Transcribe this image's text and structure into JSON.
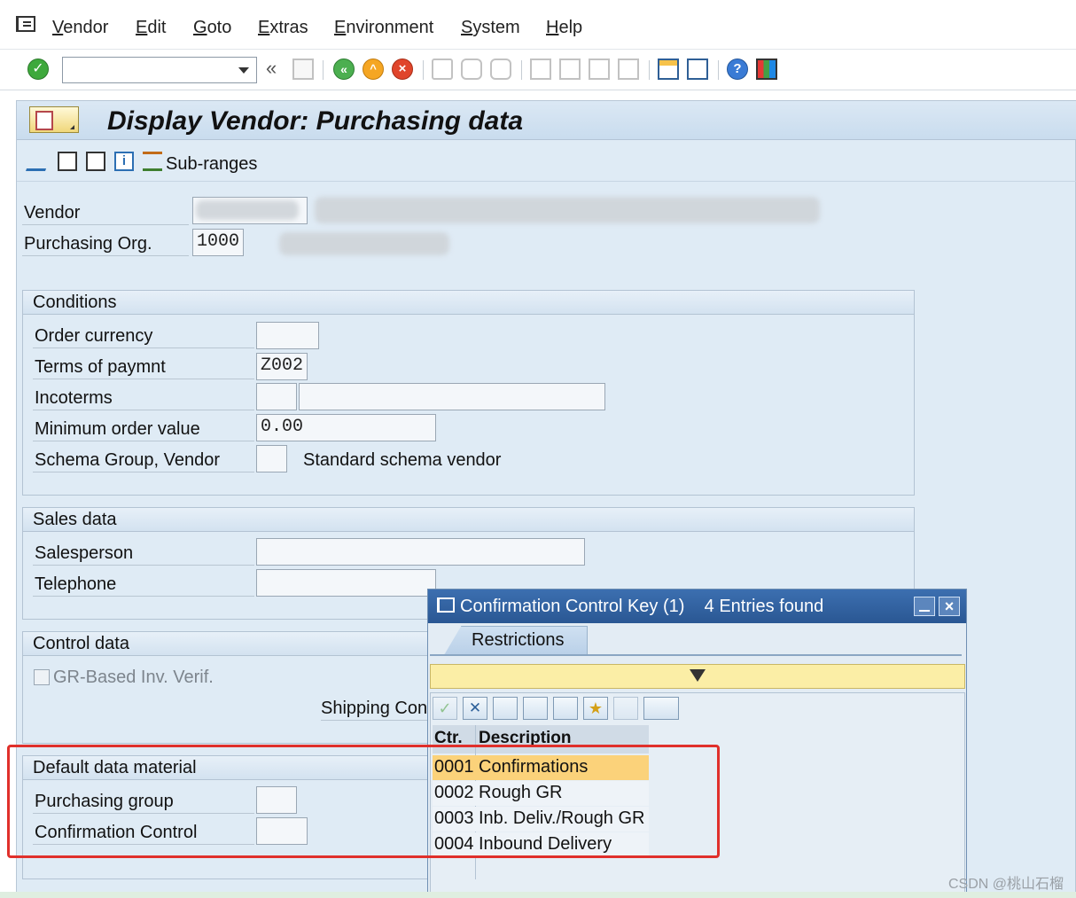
{
  "menu": {
    "items": [
      "Vendor",
      "Edit",
      "Goto",
      "Extras",
      "Environment",
      "System",
      "Help"
    ]
  },
  "toolbar": {
    "icons": [
      "enter-icon",
      "back-icon",
      "save-icon",
      "green-back-icon",
      "exit-icon",
      "cancel-icon",
      "print-icon",
      "find-icon",
      "find-next-icon",
      "first-page-icon",
      "prev-page-icon",
      "next-page-icon",
      "last-page-icon",
      "create-session-icon",
      "shortcut-icon",
      "help-icon",
      "customize-layout-icon"
    ]
  },
  "screen": {
    "title": "Display Vendor: Purchasing data",
    "subranges_label": "Sub-ranges"
  },
  "header": {
    "vendor_label": "Vendor",
    "purch_org_label": "Purchasing Org.",
    "purch_org_value": "1000"
  },
  "conditions": {
    "title": "Conditions",
    "order_currency_label": "Order currency",
    "order_currency_value": "",
    "terms_label": "Terms of paymnt",
    "terms_value": "Z002",
    "incoterms_label": "Incoterms",
    "min_order_label": "Minimum order value",
    "min_order_value": "0.00",
    "schema_label": "Schema Group, Vendor",
    "schema_text": "Standard schema vendor"
  },
  "sales": {
    "title": "Sales data",
    "salesperson_label": "Salesperson",
    "telephone_label": "Telephone"
  },
  "control": {
    "title": "Control data",
    "gr_based_label": "GR-Based Inv. Verif.",
    "shipping_label": "Shipping Conc"
  },
  "default_material": {
    "title": "Default data material",
    "purch_group_label": "Purchasing group",
    "confirmation_label": "Confirmation Control"
  },
  "popup": {
    "title": "Confirmation Control Key (1)    4 Entries found",
    "tab_label": "Restrictions",
    "col_key": "Ctr.",
    "col_desc": "Description",
    "rows": [
      {
        "key": "0001",
        "desc": "Confirmations"
      },
      {
        "key": "0002",
        "desc": "Rough GR"
      },
      {
        "key": "0003",
        "desc": "Inb. Deliv./Rough GR"
      },
      {
        "key": "0004",
        "desc": "Inbound Delivery"
      }
    ],
    "selected_row": 0
  },
  "watermark": "CSDN @桃山石榴",
  "colors": {
    "highlight_box": "#e0302b",
    "selected_row": "#fbd27a",
    "popup_title": "#2a5793"
  }
}
